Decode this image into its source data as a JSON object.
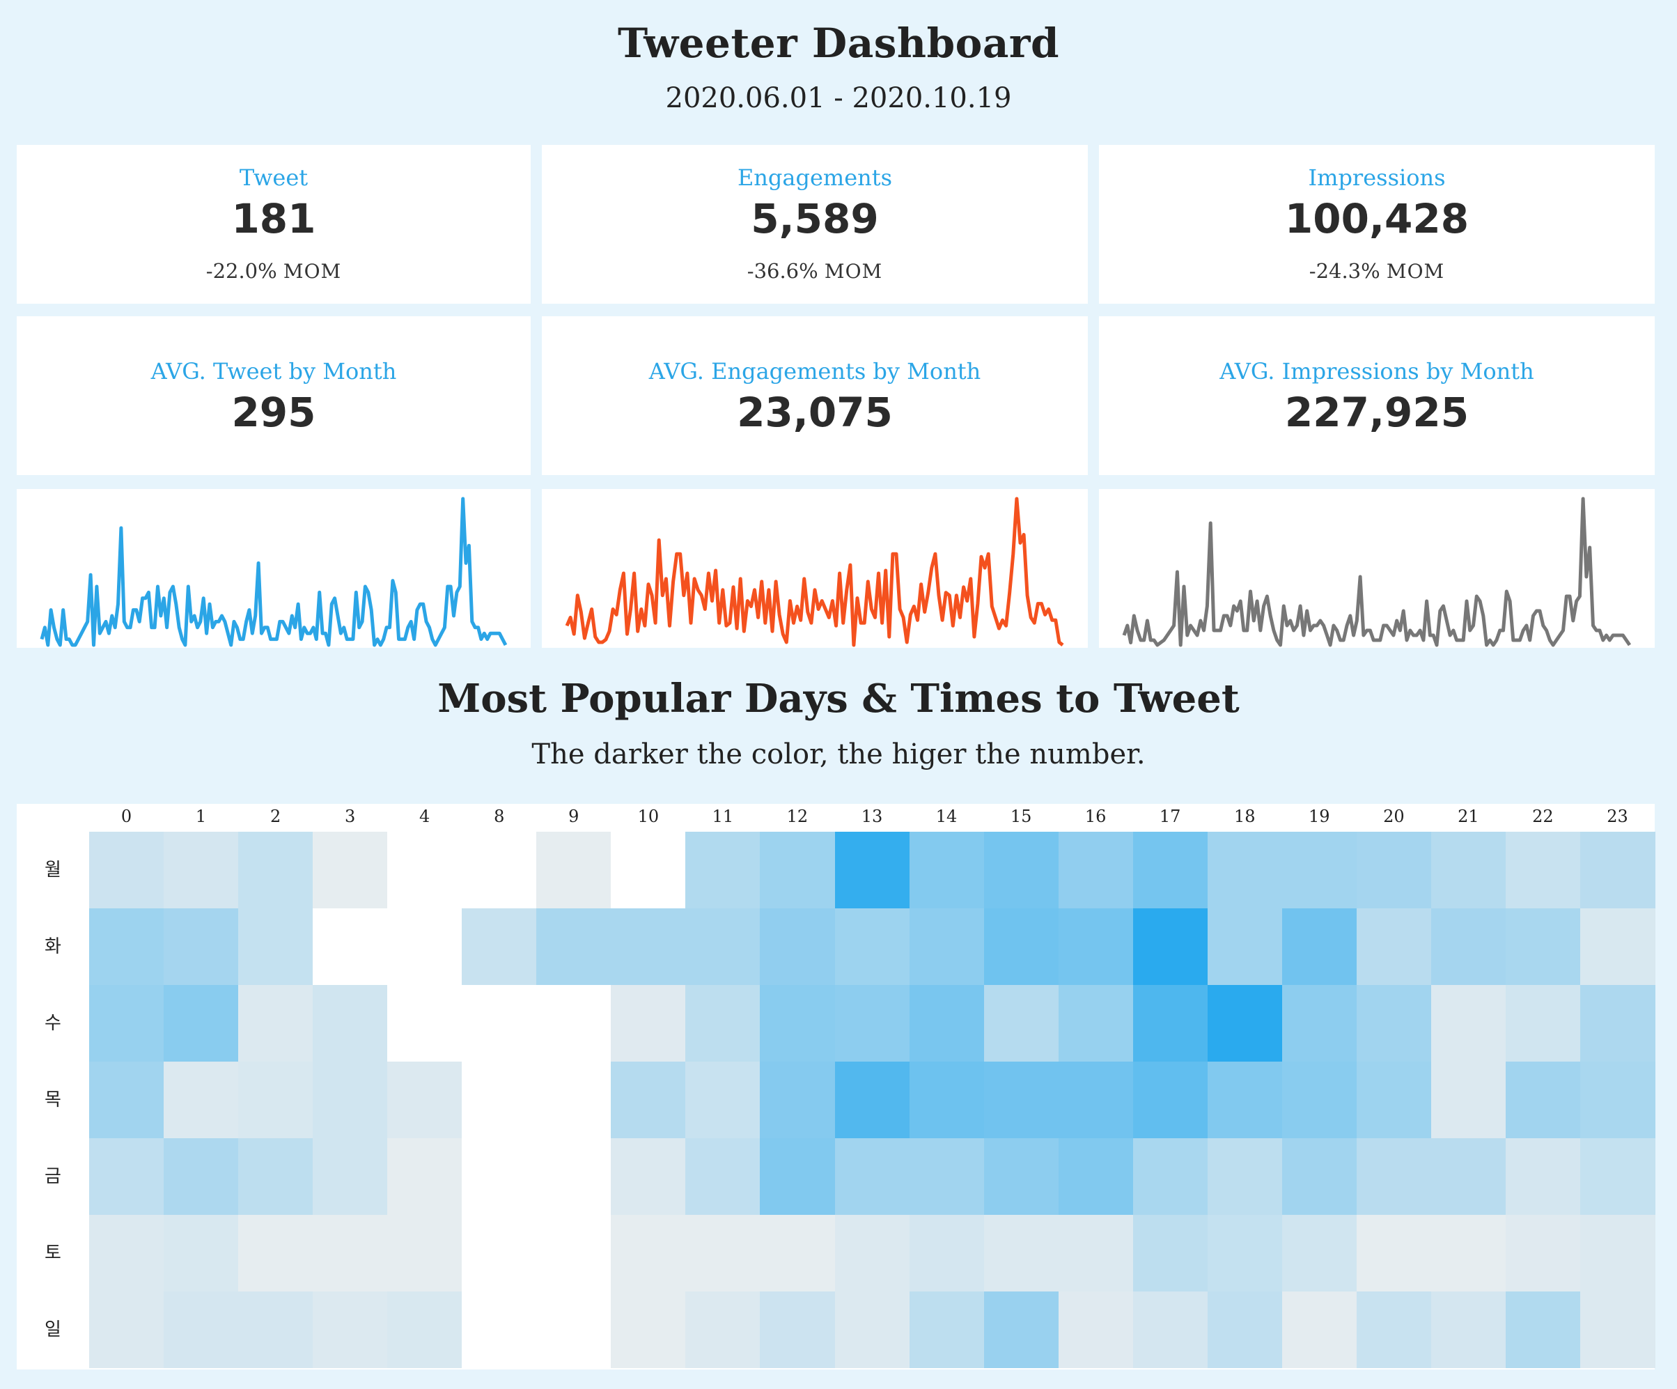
{
  "header": {
    "title": "Tweeter Dashboard",
    "date_range": "2020.06.01 - 2020.10.19"
  },
  "kpis": [
    {
      "label": "Tweet",
      "value": "181",
      "mom_value": "-22.0%",
      "mom_suffix": "MOM"
    },
    {
      "label": "Engagements",
      "value": "5,589",
      "mom_value": "-36.6%",
      "mom_suffix": "MOM"
    },
    {
      "label": "Impressions",
      "value": "100,428",
      "mom_value": "-24.3%",
      "mom_suffix": "MOM"
    }
  ],
  "averages": [
    {
      "label": "AVG. Tweet by Month",
      "value": "295"
    },
    {
      "label": "AVG. Engagements by Month",
      "value": "23,075"
    },
    {
      "label": "AVG. Impressions by Month",
      "value": "227,925"
    }
  ],
  "colors": {
    "accent": "#2ba5e6",
    "tweet_line": "#2ba5e6",
    "engagement_line": "#f4511e",
    "impression_line": "#777777",
    "background": "#e6f4fc"
  },
  "heatmap_section": {
    "title": "Most Popular Days & Times to Tweet",
    "subtitle": "The darker the color, the higer the number."
  },
  "chart_data": [
    {
      "type": "line",
      "series": [
        {
          "values": [
            1,
            3,
            0,
            6,
            3,
            1,
            0,
            6,
            1,
            1,
            0,
            0,
            1,
            2,
            3,
            4,
            12,
            0,
            10,
            2,
            3,
            4,
            2,
            5,
            3,
            7,
            20,
            4,
            3,
            3,
            6,
            6,
            4,
            8,
            8,
            9,
            3,
            3,
            10,
            5,
            8,
            3,
            9,
            10,
            7,
            3,
            1,
            0,
            10,
            4,
            5,
            3,
            4,
            8,
            2,
            7,
            3,
            4,
            4,
            5,
            4,
            2,
            0,
            4,
            3,
            1,
            1,
            4,
            6,
            2,
            5,
            14,
            2,
            3,
            3,
            1,
            1,
            1,
            4,
            4,
            3,
            2,
            5,
            3,
            7,
            1,
            3,
            2,
            2,
            3,
            1,
            9,
            2,
            2,
            0,
            7,
            8,
            5,
            2,
            3,
            1,
            1,
            1,
            9,
            3,
            4,
            10,
            9,
            6,
            0,
            1,
            0,
            1,
            3,
            3,
            11,
            9,
            1,
            1,
            1,
            3,
            4,
            1,
            6,
            7,
            7,
            4,
            3,
            1,
            0,
            1,
            2,
            3,
            10,
            10,
            5,
            9,
            10,
            25,
            14,
            17,
            4,
            3,
            3,
            1,
            2,
            1,
            2,
            2,
            2,
            2,
            1,
            0
          ]
        }
      ]
    },
    {
      "type": "line",
      "series": [
        {
          "values": [
            180,
            240,
            120,
            400,
            280,
            90,
            200,
            300,
            100,
            60,
            60,
            80,
            140,
            300,
            260,
            440,
            560,
            120,
            300,
            560,
            140,
            300,
            180,
            480,
            400,
            200,
            800,
            400,
            520,
            180,
            500,
            700,
            700,
            400,
            560,
            200,
            520,
            440,
            400,
            300,
            560,
            360,
            580,
            200,
            440,
            180,
            200,
            460,
            160,
            520,
            140,
            360,
            320,
            440,
            240,
            500,
            200,
            440,
            140,
            500,
            260,
            120,
            60,
            360,
            200,
            320,
            220,
            520,
            280,
            200,
            440,
            300,
            360,
            300,
            240,
            360,
            180,
            560,
            200,
            440,
            620,
            40,
            380,
            200,
            200,
            500,
            300,
            240,
            560,
            200,
            580,
            100,
            700,
            700,
            300,
            240,
            60,
            260,
            320,
            220,
            480,
            280,
            420,
            600,
            700,
            400,
            220,
            420,
            400,
            180,
            400,
            240,
            460,
            360,
            520,
            100,
            340,
            680,
            600,
            700,
            320,
            240,
            160,
            220,
            180,
            420,
            700,
            1100,
            780,
            840,
            400,
            240,
            200,
            340,
            340,
            260,
            300,
            220,
            220,
            60,
            40
          ]
        }
      ]
    },
    {
      "type": "line",
      "series": [
        {
          "values": [
            2000,
            4000,
            500,
            6000,
            3000,
            1000,
            1000,
            5000,
            1000,
            1000,
            0,
            500,
            1000,
            2000,
            3000,
            4000,
            15000,
            0,
            12000,
            2000,
            4000,
            3000,
            2000,
            5000,
            3000,
            8000,
            25000,
            3000,
            3000,
            3000,
            6000,
            6000,
            4000,
            8000,
            7000,
            9000,
            3000,
            3000,
            11000,
            5000,
            9000,
            3000,
            8000,
            10000,
            6000,
            3000,
            1000,
            0,
            8000,
            4000,
            5000,
            3000,
            4000,
            8000,
            2000,
            7000,
            3000,
            4000,
            4000,
            5000,
            4000,
            2000,
            0,
            4000,
            3000,
            1000,
            1000,
            4000,
            6000,
            2000,
            5000,
            14000,
            2000,
            3000,
            3000,
            1000,
            1000,
            1000,
            4000,
            4000,
            3000,
            2000,
            5000,
            3000,
            7000,
            1000,
            3000,
            2000,
            2000,
            3000,
            1000,
            9000,
            2000,
            2000,
            0,
            7000,
            8000,
            5000,
            2000,
            3000,
            1000,
            1000,
            1000,
            9000,
            3000,
            4000,
            10000,
            9000,
            6000,
            0,
            1000,
            0,
            1000,
            3000,
            3000,
            11000,
            9000,
            1000,
            1000,
            1000,
            3000,
            4000,
            1000,
            6000,
            7000,
            7000,
            4000,
            3000,
            1000,
            0,
            1000,
            2000,
            3000,
            10000,
            10000,
            5000,
            9000,
            10000,
            30000,
            14000,
            20000,
            4000,
            3000,
            3000,
            1000,
            2000,
            1000,
            2000,
            2000,
            2000,
            2000,
            1000,
            0
          ]
        }
      ]
    },
    {
      "type": "heatmap",
      "x": [
        "0",
        "1",
        "2",
        "3",
        "4",
        "8",
        "9",
        "10",
        "11",
        "12",
        "13",
        "14",
        "15",
        "16",
        "17",
        "18",
        "19",
        "20",
        "21",
        "22",
        "23"
      ],
      "y": [
        "월",
        "화",
        "수",
        "목",
        "금",
        "토",
        "일"
      ],
      "values": [
        [
          0.18,
          0.14,
          0.22,
          0.05,
          null,
          null,
          0.05,
          null,
          0.32,
          0.42,
          0.95,
          0.55,
          0.62,
          0.48,
          0.62,
          0.4,
          0.4,
          0.38,
          0.3,
          0.2,
          0.28
        ],
        [
          0.42,
          0.38,
          0.22,
          null,
          null,
          0.2,
          0.36,
          0.36,
          0.36,
          0.48,
          0.42,
          0.5,
          0.65,
          0.62,
          1.0,
          0.4,
          0.64,
          0.28,
          0.38,
          0.36,
          0.12
        ],
        [
          0.45,
          0.52,
          0.1,
          0.16,
          null,
          null,
          null,
          0.08,
          0.26,
          0.52,
          0.5,
          0.6,
          0.3,
          0.45,
          0.82,
          1.0,
          0.5,
          0.4,
          0.1,
          0.16,
          0.34
        ],
        [
          0.4,
          0.1,
          0.12,
          0.16,
          0.1,
          null,
          null,
          0.3,
          0.2,
          0.54,
          0.8,
          0.66,
          0.64,
          0.64,
          0.72,
          0.56,
          0.52,
          0.42,
          0.1,
          0.4,
          0.36
        ],
        [
          0.24,
          0.34,
          0.26,
          0.16,
          0.05,
          null,
          null,
          0.1,
          0.24,
          0.56,
          0.4,
          0.4,
          0.5,
          0.56,
          0.36,
          0.26,
          0.4,
          0.28,
          0.28,
          0.14,
          0.22
        ],
        [
          0.1,
          0.12,
          0.05,
          0.05,
          0.05,
          null,
          null,
          0.05,
          0.05,
          0.05,
          0.1,
          0.14,
          0.1,
          0.1,
          0.26,
          0.22,
          0.16,
          0.05,
          0.05,
          0.08,
          0.1
        ],
        [
          0.1,
          0.14,
          0.14,
          0.1,
          0.12,
          null,
          null,
          0.05,
          0.1,
          0.18,
          0.1,
          0.26,
          0.44,
          0.08,
          0.14,
          0.24,
          0.06,
          0.2,
          0.14,
          0.32,
          0.1
        ]
      ]
    }
  ]
}
